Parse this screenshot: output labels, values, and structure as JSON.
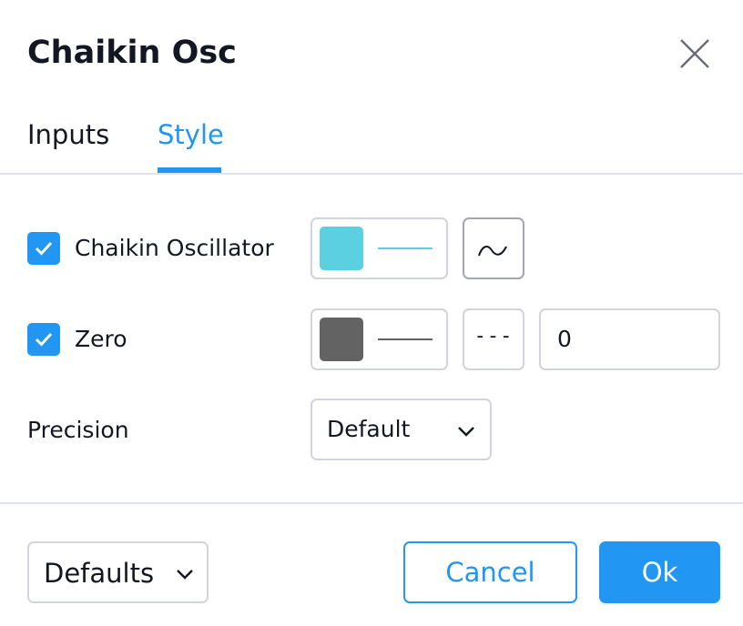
{
  "dialog": {
    "title": "Chaikin Osc"
  },
  "tabs": [
    {
      "label": "Inputs"
    },
    {
      "label": "Style"
    }
  ],
  "rows": {
    "oscillator": {
      "label": "Chaikin Oscillator",
      "checked": true,
      "color": "#5bd0e0"
    },
    "zero": {
      "label": "Zero",
      "checked": true,
      "color": "#636363",
      "line_style_glyph": "---",
      "value": "0"
    },
    "precision": {
      "label": "Precision",
      "selected": "Default"
    }
  },
  "footer": {
    "defaults_label": "Defaults",
    "cancel_label": "Cancel",
    "ok_label": "Ok"
  },
  "colors": {
    "accent": "#2196f3",
    "border": "#d1d4dc",
    "divider": "#e0e3eb"
  }
}
